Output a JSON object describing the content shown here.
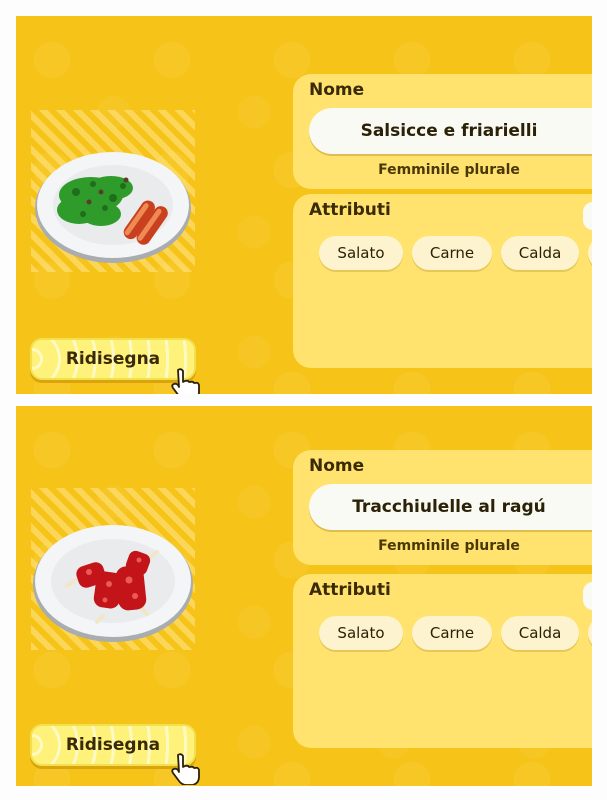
{
  "screens": [
    {
      "name_label": "Nome",
      "dish_name": "Salsicce e friarielli",
      "gender": "Femminile plurale",
      "attributes_label": "Attributi",
      "tags": [
        "Salato",
        "Carne",
        "Calda",
        ""
      ],
      "redraw_label": "Ridisegna",
      "dish_icon": "sausage-greens-icon"
    },
    {
      "name_label": "Nome",
      "dish_name": "Tracchiulelle al ragú",
      "gender": "Femminile plurale",
      "attributes_label": "Attributi",
      "tags": [
        "Salato",
        "Carne",
        "Calda",
        ""
      ],
      "redraw_label": "Ridisegna",
      "dish_icon": "ribs-ragu-icon"
    }
  ],
  "colors": {
    "background": "#f6c318",
    "box": "#ffe36e",
    "button": "#fff27a"
  }
}
